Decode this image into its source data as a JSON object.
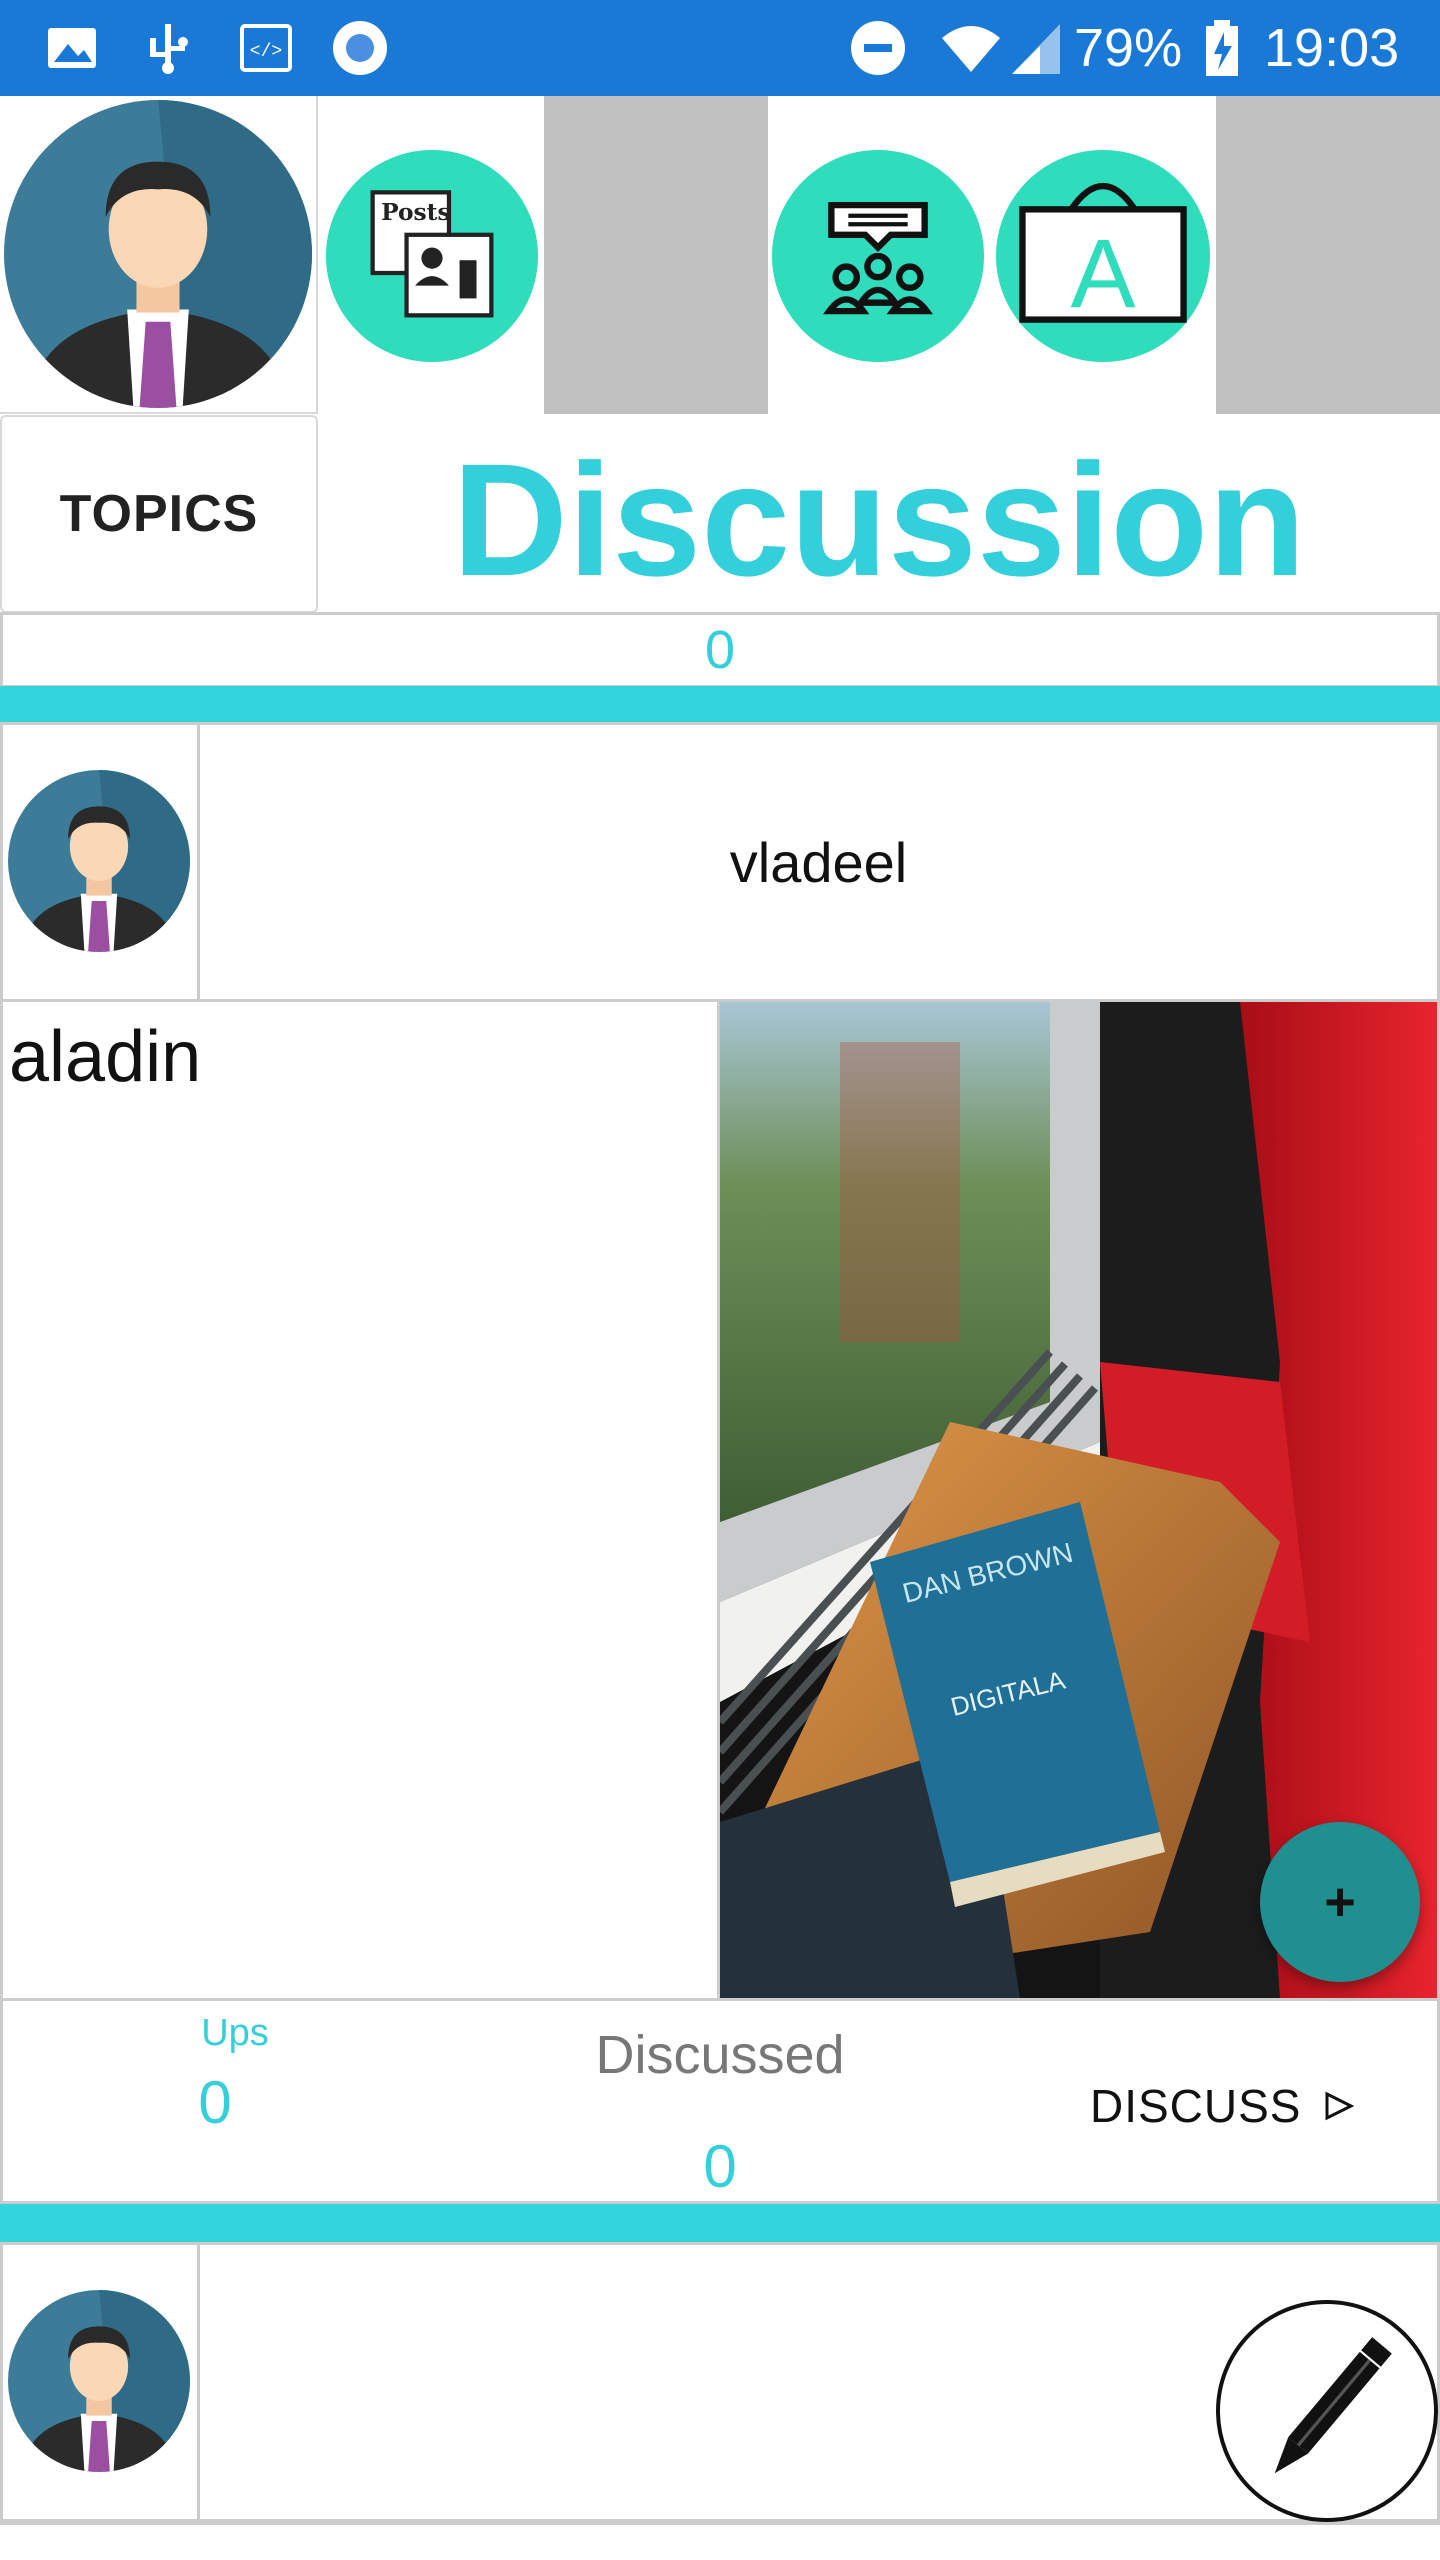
{
  "status_bar": {
    "battery": "79%",
    "time": "19:03",
    "icons_left": [
      "image-icon",
      "usb-icon",
      "code-icon",
      "record-icon"
    ],
    "icons_right": [
      "dnd-icon",
      "wifi-icon",
      "signal-icon",
      "battery-charging-icon"
    ]
  },
  "header": {
    "nav_icons": [
      {
        "name": "posts-icon",
        "label": "Posts"
      },
      {
        "name": "community-icon",
        "label": ""
      },
      {
        "name": "alphabet-board-icon",
        "label": "A"
      }
    ],
    "topics_label": "TOPICS",
    "title": "Discussion",
    "topic_count": "0"
  },
  "post": {
    "username": "vladeel",
    "title": "aladin",
    "ups_label": "Ups",
    "ups_value": "0",
    "discussed_label": "Discussed",
    "discussed_value": "0",
    "discuss_label": "DISCUSS",
    "discuss_icon": "play-outline-icon",
    "add_label": "+"
  },
  "photo": {
    "book_author": "DAN BROWN",
    "book_title": "DIGITALA"
  },
  "colors": {
    "accent": "#33d0dc",
    "status_bar": "#1a78d6",
    "icon_bg": "#2fdcbc",
    "fab": "#1f8f8f"
  }
}
